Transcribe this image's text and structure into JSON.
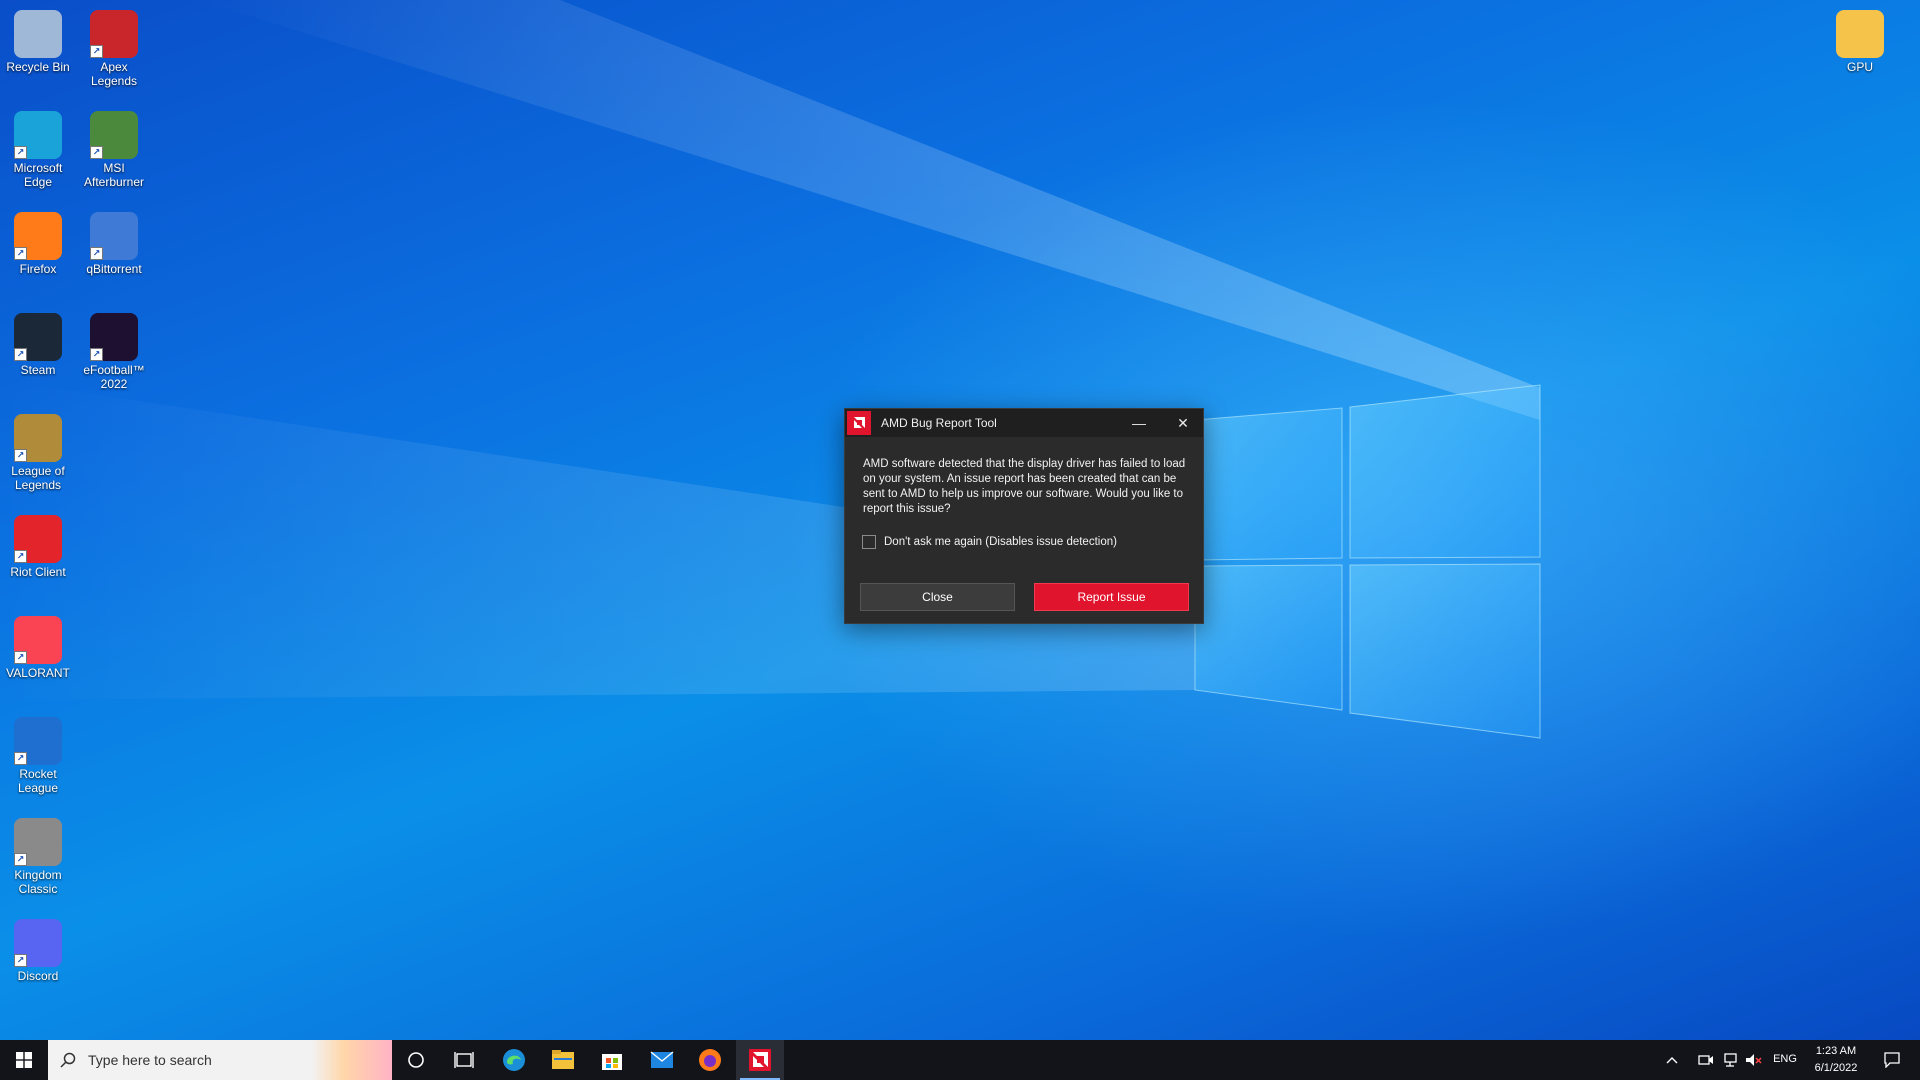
{
  "desktop": {
    "icons_left_col1": [
      {
        "label": "Recycle Bin",
        "icon": "recycle-bin-icon",
        "color": "#9fb8d8"
      },
      {
        "label": "Microsoft Edge",
        "icon": "edge-icon",
        "color": "#1aa3d8"
      },
      {
        "label": "Firefox",
        "icon": "firefox-icon",
        "color": "#ff7b1a"
      },
      {
        "label": "Steam",
        "icon": "steam-icon",
        "color": "#1b2838"
      },
      {
        "label": "League of Legends",
        "icon": "league-of-legends-icon",
        "color": "#b08b3a"
      },
      {
        "label": "Riot Client",
        "icon": "riot-client-icon",
        "color": "#e3242b"
      },
      {
        "label": "VALORANT",
        "icon": "valorant-icon",
        "color": "#fa4454"
      },
      {
        "label": "Rocket League",
        "icon": "rocket-league-icon",
        "color": "#1f6fd0"
      },
      {
        "label": "Kingdom Classic",
        "icon": "kingdom-classic-icon",
        "color": "#8a8a8a"
      },
      {
        "label": "Discord",
        "icon": "discord-icon",
        "color": "#5865f2"
      }
    ],
    "icons_left_col2": [
      {
        "label": "Apex Legends",
        "icon": "apex-legends-icon",
        "color": "#c9262c"
      },
      {
        "label": "MSI Afterburner",
        "icon": "msi-afterburner-icon",
        "color": "#4b8a3c"
      },
      {
        "label": "qBittorrent",
        "icon": "qbittorrent-icon",
        "color": "#3e7ad6"
      },
      {
        "label": "eFootball™ 2022",
        "icon": "efootball-icon",
        "color": "#1d1030"
      }
    ],
    "icons_right": [
      {
        "label": "GPU",
        "icon": "folder-icon",
        "color": "#f5c24a"
      }
    ]
  },
  "dialog": {
    "title": "AMD Bug Report Tool",
    "message": "AMD software detected that the display driver has failed to load on your system. An issue report has been created that can be sent to AMD to help us improve our software. Would you like to report this issue?",
    "checkbox_label": "Don't ask me again (Disables issue detection)",
    "checkbox_checked": false,
    "close_label": "Close",
    "report_label": "Report Issue",
    "accent_color": "#e1142d",
    "minimize_glyph": "—",
    "close_glyph": "✕"
  },
  "taskbar": {
    "search_placeholder": "Type here to search",
    "pinned": [
      "cortana-icon",
      "task-view-icon",
      "edge-icon",
      "file-explorer-icon",
      "microsoft-store-icon",
      "mail-icon",
      "firefox-icon",
      "amd-icon"
    ],
    "language": "ENG",
    "time": "1:23 AM",
    "date": "6/1/2022"
  }
}
